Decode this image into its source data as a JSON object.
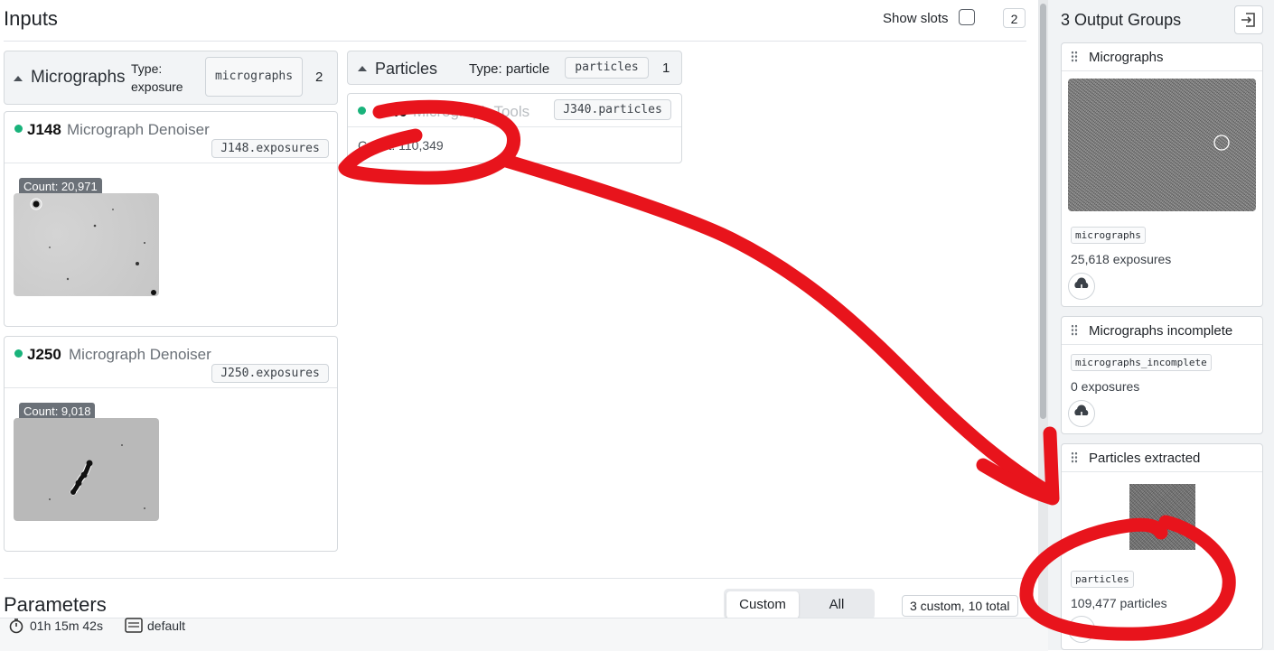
{
  "inputs": {
    "title": "Inputs",
    "show_slots_label": "Show slots",
    "count": "2"
  },
  "groups": {
    "micrographs": {
      "name": "Micrographs",
      "type_label": "Type:",
      "type_value": "exposure",
      "slot": "micrographs",
      "count": "2",
      "jobs": [
        {
          "id": "J148",
          "name": "Micrograph Denoiser",
          "output": "J148.exposures",
          "count": "Count: 20,971"
        },
        {
          "id": "J250",
          "name": "Micrograph Denoiser",
          "output": "J250.exposures",
          "count": "Count: 9,018"
        }
      ]
    },
    "particles": {
      "name": "Particles",
      "type": "Type: particle",
      "slot": "particles",
      "count": "1",
      "job": {
        "id": "J340",
        "name": "Micrograph Tools",
        "output": "J340.particles",
        "count": "Count: 110,349"
      }
    }
  },
  "parameters": {
    "title": "Parameters",
    "tab_custom": "Custom",
    "tab_all": "All",
    "summary": "3 custom, 10 total"
  },
  "status_bar": {
    "time": "01h 15m 42s",
    "lane": "default"
  },
  "output_groups": {
    "title": "3 Output Groups",
    "items": [
      {
        "name": "Micrographs",
        "slot": "micrographs",
        "count": "25,618 exposures"
      },
      {
        "name": "Micrographs incomplete",
        "slot": "micrographs_incomplete",
        "count": "0 exposures"
      },
      {
        "name": "Particles extracted",
        "slot": "particles",
        "count": "109,477 particles"
      }
    ]
  },
  "annotation": {
    "color": "#e8141c"
  },
  "colors": {
    "status_dot": "#19b37b",
    "badge": "#6b7178"
  }
}
